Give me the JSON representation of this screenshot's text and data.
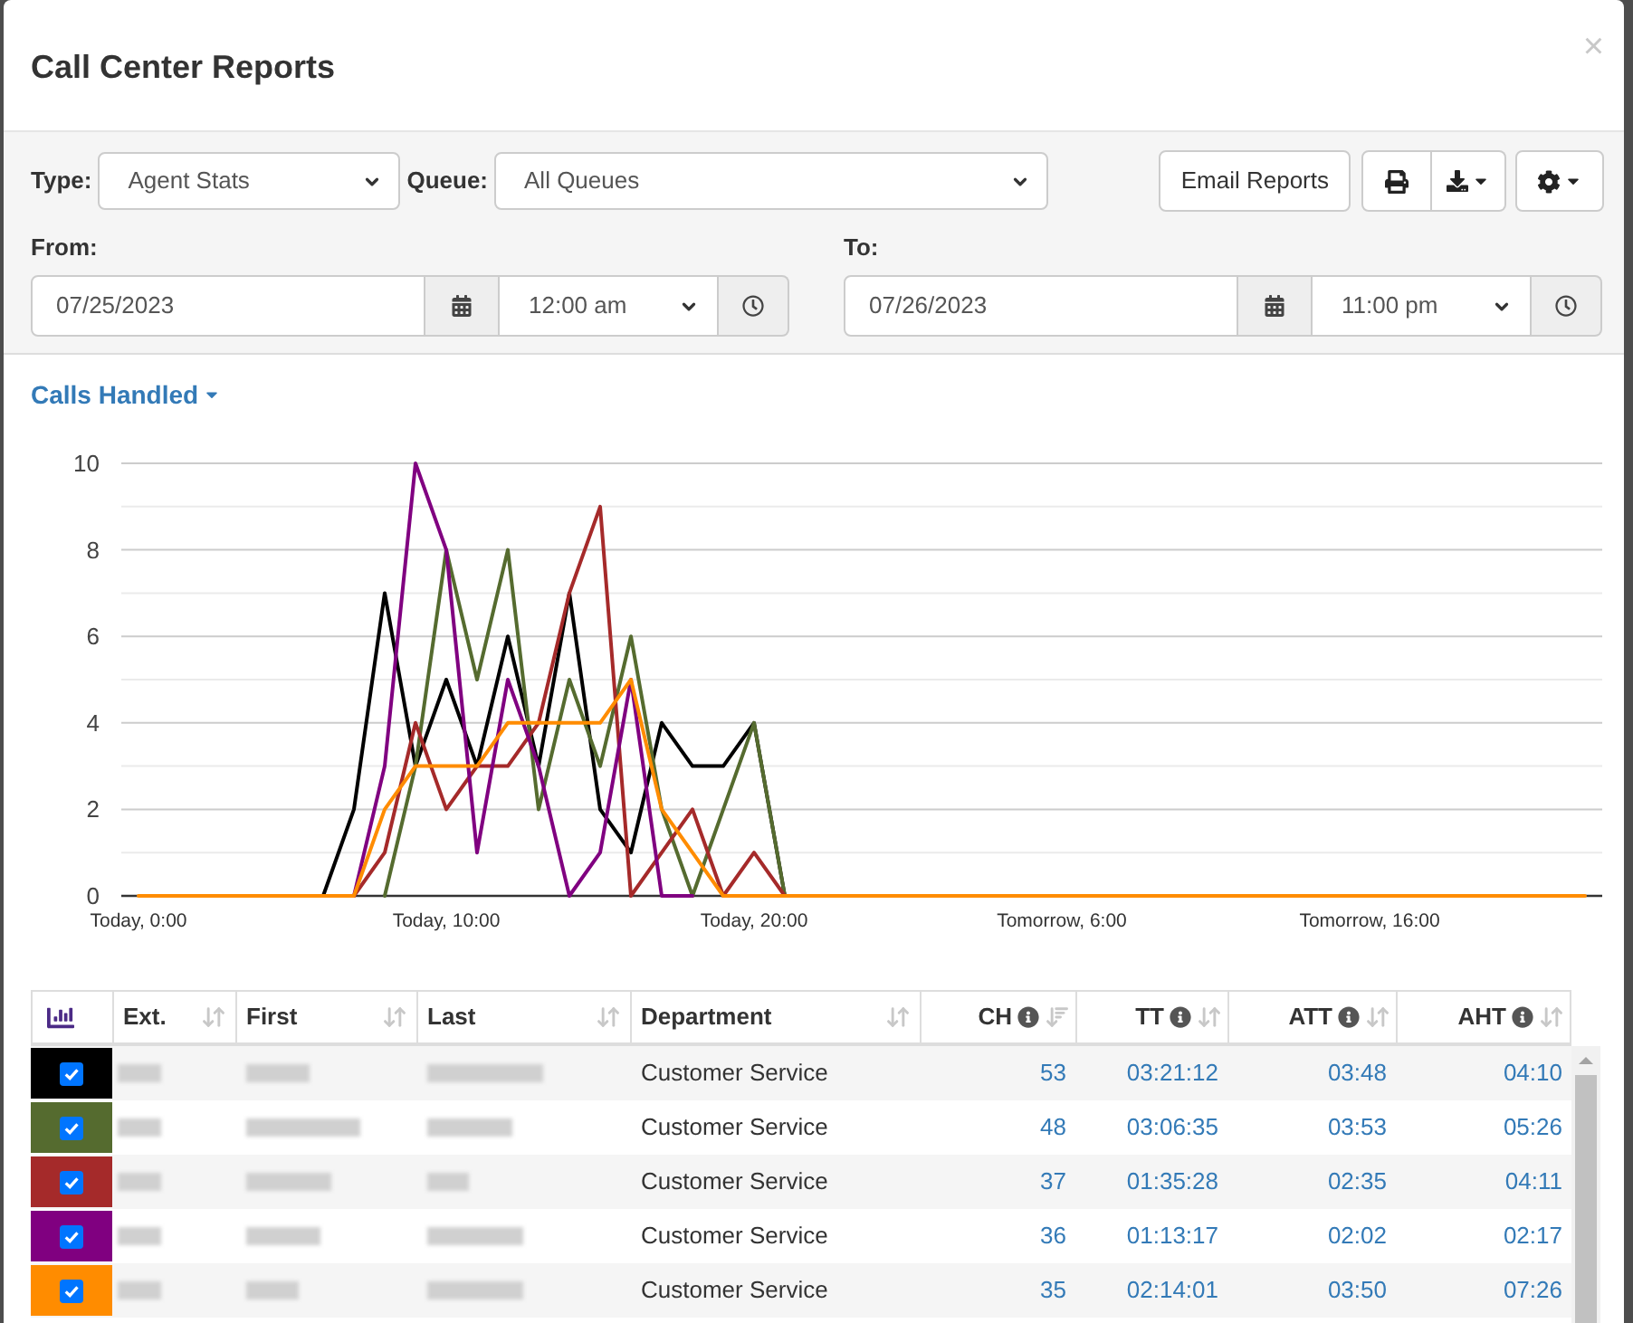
{
  "dialog": {
    "title": "Call Center Reports",
    "close": "×"
  },
  "filters": {
    "type": {
      "label": "Type:",
      "value": "Agent Stats"
    },
    "queue": {
      "label": "Queue:",
      "value": "All Queues"
    },
    "email_button": "Email Reports",
    "from": {
      "label": "From:",
      "date": "07/25/2023",
      "time": "12:00 am"
    },
    "to": {
      "label": "To:",
      "date": "07/26/2023",
      "time": "11:00 pm"
    }
  },
  "chart": {
    "metric_menu": "Calls Handled",
    "chart_data": {
      "type": "line",
      "grid": true,
      "categories": [
        "Today, 0:00",
        null,
        null,
        null,
        null,
        null,
        null,
        null,
        null,
        null,
        "Today, 10:00",
        null,
        null,
        null,
        null,
        null,
        null,
        null,
        null,
        null,
        "Today, 20:00",
        null,
        null,
        null,
        null,
        null,
        null,
        null,
        null,
        null,
        "Tomorrow, 6:00",
        null,
        null,
        null,
        null,
        null,
        null,
        null,
        null,
        null,
        "Tomorrow, 16:00",
        null,
        null,
        null,
        null,
        null,
        null,
        null
      ],
      "ylim": [
        0,
        10
      ],
      "yticks": [
        0,
        2,
        4,
        6,
        8,
        10
      ],
      "series": [
        {
          "color": "#000000",
          "values": [
            null,
            null,
            null,
            null,
            null,
            null,
            0,
            2,
            7,
            3,
            5,
            3,
            6,
            3,
            7,
            2,
            1,
            4,
            3,
            3,
            4,
            0,
            null,
            null,
            null,
            null,
            null,
            null,
            null,
            null,
            null,
            null,
            null,
            null,
            null,
            null,
            null,
            null,
            null,
            null,
            null,
            null,
            null,
            null,
            null,
            null,
            null,
            null
          ]
        },
        {
          "color": "#556b2f",
          "values": [
            null,
            null,
            null,
            null,
            null,
            null,
            null,
            null,
            0,
            3,
            8,
            5,
            8,
            2,
            5,
            3,
            6,
            2,
            0,
            2,
            4,
            0,
            null,
            null,
            null,
            null,
            null,
            null,
            null,
            null,
            null,
            null,
            null,
            null,
            null,
            null,
            null,
            null,
            null,
            null,
            null,
            null,
            null,
            null,
            null,
            null,
            null,
            null
          ]
        },
        {
          "color": "#a52a2a",
          "values": [
            null,
            null,
            null,
            null,
            null,
            null,
            null,
            0,
            1,
            4,
            2,
            3,
            3,
            4,
            7,
            9,
            0,
            1,
            2,
            0,
            1,
            0,
            null,
            null,
            null,
            null,
            null,
            null,
            null,
            null,
            null,
            null,
            null,
            null,
            null,
            null,
            null,
            null,
            null,
            null,
            null,
            null,
            null,
            null,
            null,
            null,
            null,
            null
          ]
        },
        {
          "color": "#800080",
          "values": [
            null,
            null,
            null,
            null,
            null,
            null,
            null,
            0,
            3,
            10,
            8,
            1,
            5,
            3,
            0,
            1,
            5,
            0,
            0,
            null,
            null,
            null,
            null,
            null,
            null,
            null,
            null,
            null,
            null,
            null,
            null,
            null,
            null,
            null,
            null,
            null,
            null,
            null,
            null,
            null,
            null,
            null,
            null,
            null,
            null,
            null,
            null,
            null
          ]
        },
        {
          "color": "#ff8c00",
          "values": [
            0,
            0,
            0,
            0,
            0,
            0,
            0,
            0,
            2,
            3,
            3,
            3,
            4,
            4,
            4,
            4,
            5,
            2,
            1,
            0,
            0,
            0,
            0,
            0,
            0,
            0,
            0,
            0,
            0,
            0,
            0,
            0,
            0,
            0,
            0,
            0,
            0,
            0,
            0,
            0,
            0,
            0,
            0,
            0,
            0,
            0,
            0,
            0
          ]
        }
      ]
    }
  },
  "table": {
    "columns": [
      {
        "kind": "chart"
      },
      {
        "kind": "blurred",
        "label": "Ext.",
        "info": false,
        "sorted": false
      },
      {
        "kind": "blurred",
        "label": "First",
        "info": false,
        "sorted": false
      },
      {
        "kind": "blurred",
        "label": "Last",
        "info": false,
        "sorted": false
      },
      {
        "kind": "text",
        "label": "Department",
        "info": false,
        "sorted": false
      },
      {
        "kind": "number",
        "label": "CH",
        "info": true,
        "sorted": true
      },
      {
        "kind": "number",
        "label": "TT",
        "info": true,
        "sorted": false
      },
      {
        "kind": "number",
        "label": "ATT",
        "info": true,
        "sorted": false
      },
      {
        "kind": "number",
        "label": "AHT",
        "info": true,
        "sorted": false
      }
    ],
    "rows": [
      {
        "color": "#000000",
        "checked": true,
        "department": "Customer Service",
        "metrics": [
          "53",
          "03:21:12",
          "03:48",
          "04:10"
        ]
      },
      {
        "color": "#556b2f",
        "checked": true,
        "department": "Customer Service",
        "metrics": [
          "48",
          "03:06:35",
          "03:53",
          "05:26"
        ]
      },
      {
        "color": "#a52a2a",
        "checked": true,
        "department": "Customer Service",
        "metrics": [
          "37",
          "01:35:28",
          "02:35",
          "04:11"
        ]
      },
      {
        "color": "#800080",
        "checked": true,
        "department": "Customer Service",
        "metrics": [
          "36",
          "01:13:17",
          "02:02",
          "02:17"
        ]
      },
      {
        "color": "#ff8c00",
        "checked": true,
        "department": "Customer Service",
        "metrics": [
          "35",
          "02:14:01",
          "03:50",
          "07:26"
        ]
      }
    ]
  }
}
